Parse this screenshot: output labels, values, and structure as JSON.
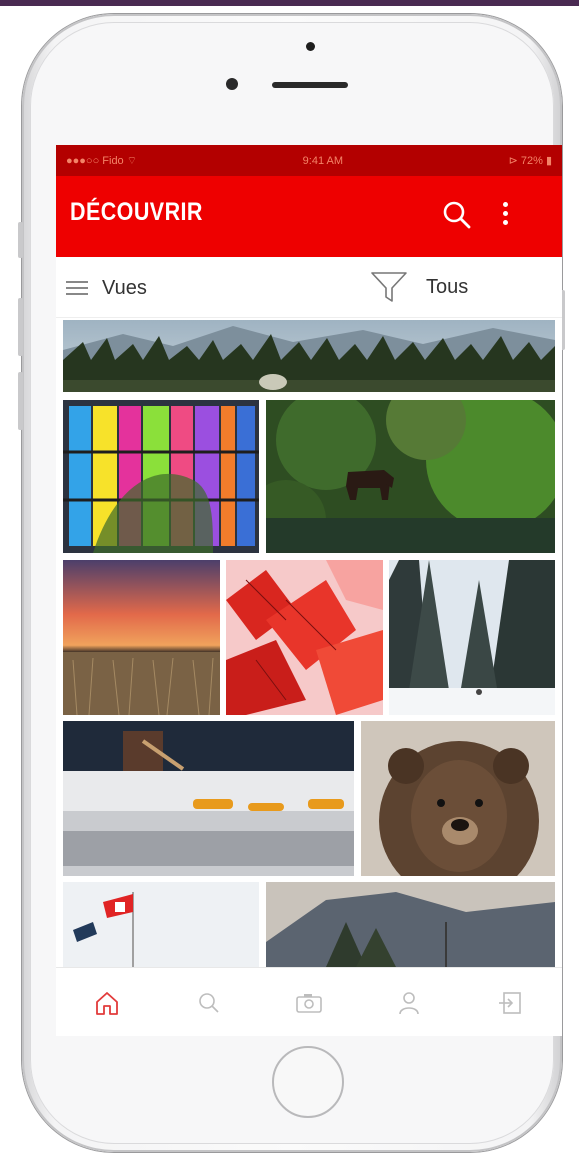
{
  "status_bar": {
    "carrier": "●●●○○ Fido ⌔",
    "time": "9:41 AM",
    "battery": "⊳ 72% ▮"
  },
  "app_bar": {
    "title": "DÉCOUVRIR"
  },
  "toolbar": {
    "views_label": "Vues",
    "filter_label": "Tous"
  },
  "gallery": {
    "photos": [
      "mountain-forest-panorama",
      "colorful-glass-building",
      "moose-in-forest",
      "sunset-wheat-field",
      "red-maple-leaves",
      "snowy-pine-forest",
      "maple-syrup-on-snow",
      "grizzly-bear",
      "canadian-flags",
      "mountain-landscape"
    ]
  },
  "tab_bar": {
    "tabs": [
      {
        "icon": "home-icon",
        "active": true
      },
      {
        "icon": "search-icon",
        "active": false
      },
      {
        "icon": "camera-icon",
        "active": false
      },
      {
        "icon": "profile-icon",
        "active": false
      },
      {
        "icon": "logout-icon",
        "active": false
      }
    ],
    "active_color": "#e23b3b",
    "inactive_color": "#bdbdbd"
  },
  "colors": {
    "brand": "#ee0000",
    "status_bar": "#b30000"
  }
}
